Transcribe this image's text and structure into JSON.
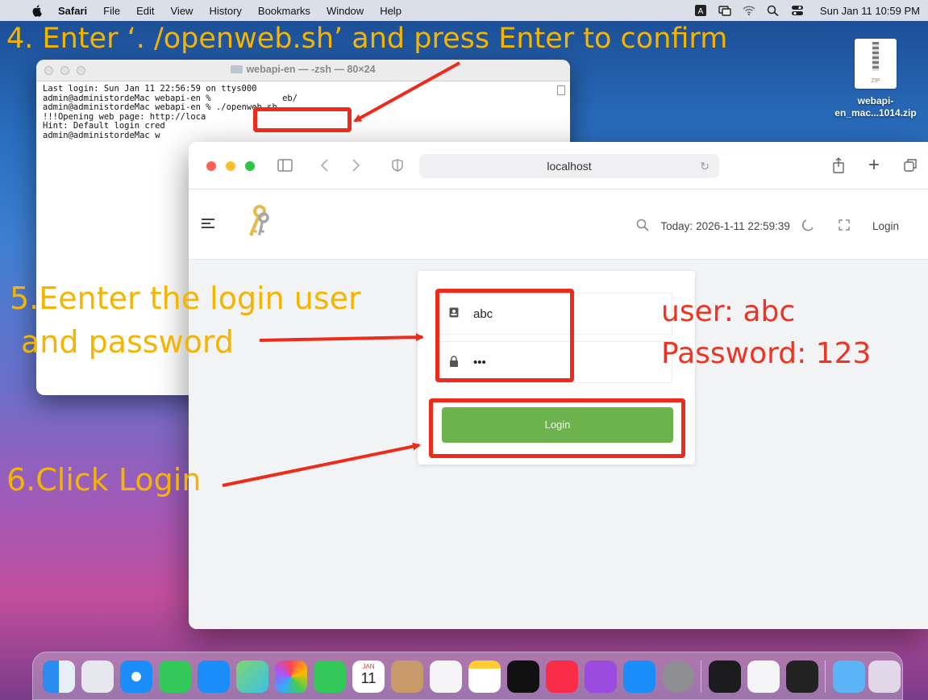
{
  "menubar": {
    "app": "Safari",
    "items": [
      "File",
      "Edit",
      "View",
      "History",
      "Bookmarks",
      "Window",
      "Help"
    ],
    "clock": "Sun Jan 11  10:59 PM"
  },
  "annotations": {
    "step4": "4. Enter  ‘. /openweb.sh’  and press Enter to confirm",
    "step5_line1": "5.Eenter the login user",
    "step5_line2": "and password",
    "step6": "6.Click Login",
    "creds_user": "user:  abc",
    "creds_pass": "Password:  123"
  },
  "desktop_file": {
    "icon_label": "ZIP",
    "name_line1": "webapi-",
    "name_line2": "en_mac...1014.zip"
  },
  "terminal": {
    "title": "webapi-en — -zsh — 80×24",
    "lines": [
      "Last login: Sun Jan 11 22:56:59 on ttys000",
      "admin@administordeMac webapi-en %              eb/",
      "admin@administordeMac webapi-en % ./openweb.sh",
      "!!!Opening web page: http://loca",
      "Hint: Default login cred",
      "admin@administordeMac w"
    ]
  },
  "safari": {
    "address": "localhost",
    "header": {
      "today_label": "Today:",
      "today_value": "2026-1-11 22:59:39",
      "login_link": "Login"
    },
    "login_form": {
      "username_value": "abc",
      "password_value": "•••",
      "button_label": "Login"
    }
  },
  "dock": {
    "calendar_month": "JAN",
    "calendar_day": "11",
    "items": [
      "finder",
      "launchpad",
      "safari",
      "messages",
      "mail",
      "maps",
      "photos",
      "facetime",
      "calendar",
      "contacts",
      "reminders",
      "notes",
      "tv",
      "music",
      "podcasts",
      "app-store",
      "system-preferences",
      "terminal",
      "textedit",
      "console",
      "downloads",
      "trash"
    ]
  }
}
